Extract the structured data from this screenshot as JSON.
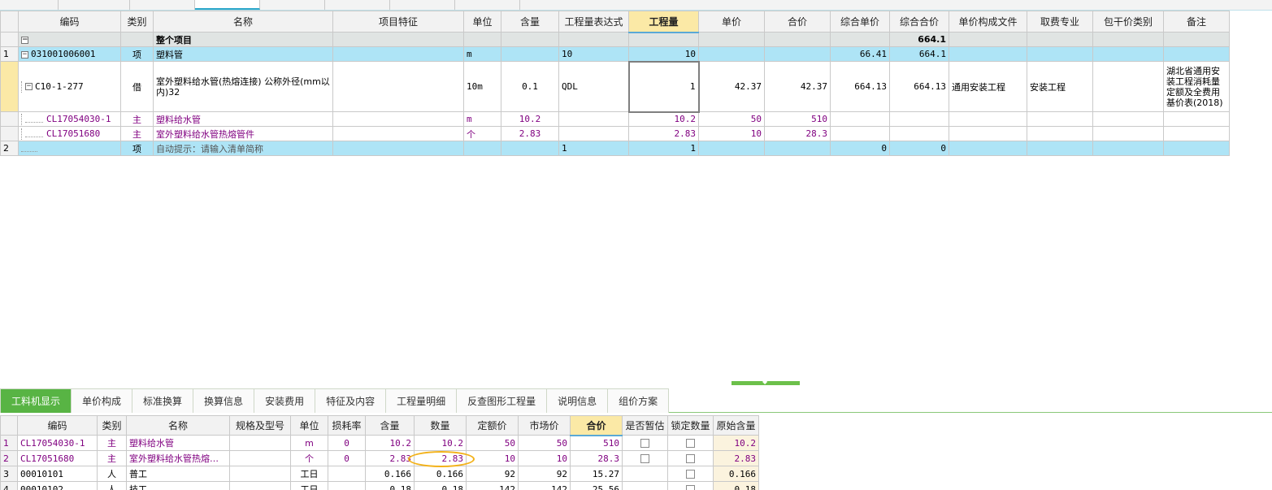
{
  "top_grid": {
    "headers": [
      "编码",
      "类别",
      "名称",
      "项目特征",
      "单位",
      "含量",
      "工程量表达式",
      "工程量",
      "单价",
      "合价",
      "综合单价",
      "综合合价",
      "单价构成文件",
      "取费专业",
      "包干价类别",
      "备注"
    ],
    "whole": {
      "collapse": "−",
      "name": "整个项目",
      "total": "664.1"
    },
    "item1": {
      "rownum": "1",
      "collapse": "−",
      "code": "031001006001",
      "type": "项",
      "name": "塑料管",
      "unit": "m",
      "expr": "10",
      "qty": "10",
      "unit_price": "66.41",
      "total": "664.1"
    },
    "sub1": {
      "collapse": "−",
      "code": "C10-1-277",
      "type": "借",
      "name": "室外塑料给水管(热熔连接) 公称外径(mm以内)32",
      "unit": "10m",
      "content": "0.1",
      "expr": "QDL",
      "qty": "1",
      "price": "42.37",
      "sum": "42.37",
      "unit_price": "664.13",
      "total": "664.13",
      "file": "通用安装工程",
      "fee": "安装工程",
      "remark": "湖北省通用安装工程消耗量定额及全费用基价表(2018)"
    },
    "mat1": {
      "code": "CL17054030-1",
      "type": "主",
      "name": "塑料给水管",
      "unit": "m",
      "content": "10.2",
      "qty": "10.2",
      "price": "50",
      "sum": "510"
    },
    "mat2": {
      "code": "CL17051680",
      "type": "主",
      "name": "室外塑料给水管热熔管件",
      "unit": "个",
      "content": "2.83",
      "qty": "2.83",
      "price": "10",
      "sum": "28.3"
    },
    "item2": {
      "rownum": "2",
      "type": "项",
      "name": "自动提示：请输入清单简称",
      "expr": "1",
      "qty": "1",
      "unit_price": "0",
      "total": "0"
    }
  },
  "bottom_tabs": [
    "工料机显示",
    "单价构成",
    "标准换算",
    "换算信息",
    "安装费用",
    "特征及内容",
    "工程量明细",
    "反查图形工程量",
    "说明信息",
    "组价方案"
  ],
  "bottom_grid": {
    "headers": [
      "编码",
      "类别",
      "名称",
      "规格及型号",
      "单位",
      "损耗率",
      "含量",
      "数量",
      "定额价",
      "市场价",
      "合价",
      "是否暂估",
      "锁定数量",
      "原始含量"
    ],
    "rows": [
      {
        "n": "1",
        "code": "CL17054030-1",
        "type": "主",
        "name": "塑料给水管",
        "spec": "",
        "unit": "m",
        "loss": "0",
        "content": "10.2",
        "qty": "10.2",
        "quota": "50",
        "market": "50",
        "sum": "510",
        "orig": "10.2"
      },
      {
        "n": "2",
        "code": "CL17051680",
        "type": "主",
        "name": "室外塑料给水管热熔…",
        "spec": "",
        "unit": "个",
        "loss": "0",
        "content": "2.83",
        "qty": "2.83",
        "quota": "10",
        "market": "10",
        "sum": "28.3",
        "orig": "2.83"
      },
      {
        "n": "3",
        "code": "00010101",
        "type": "人",
        "name": "普工",
        "spec": "",
        "unit": "工日",
        "loss": "",
        "content": "0.166",
        "qty": "0.166",
        "quota": "92",
        "market": "92",
        "sum": "15.27",
        "orig": "0.166"
      },
      {
        "n": "4",
        "code": "00010102",
        "type": "人",
        "name": "技工",
        "spec": "",
        "unit": "工日",
        "loss": "",
        "content": "0.18",
        "qty": "0.18",
        "quota": "142",
        "market": "142",
        "sum": "25.56",
        "orig": "0.18"
      }
    ]
  }
}
